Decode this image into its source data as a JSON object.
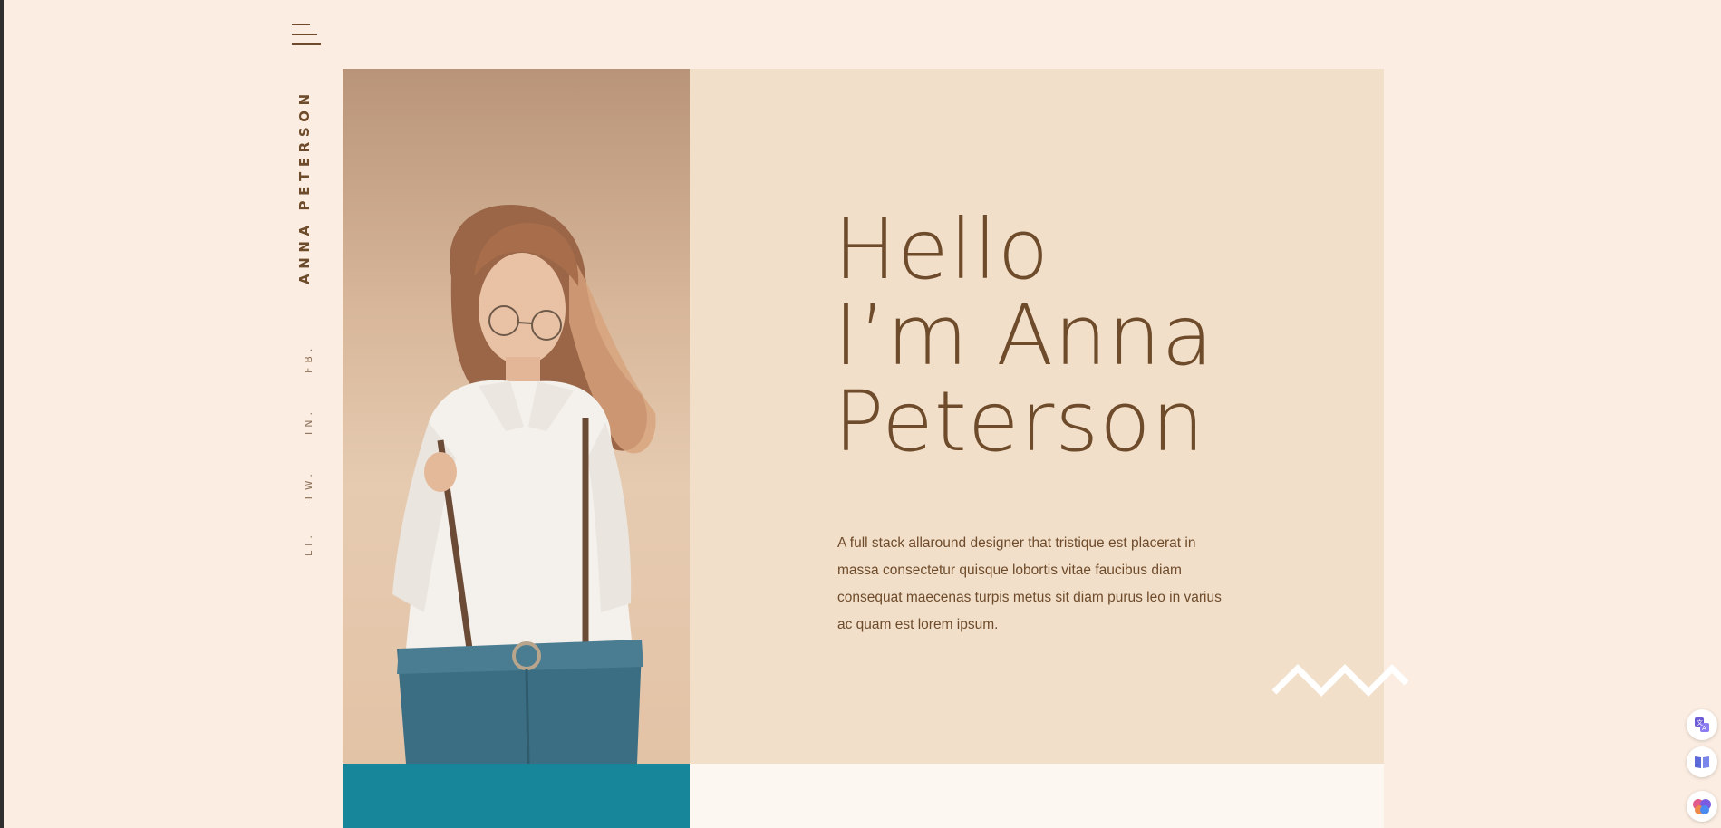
{
  "header": {
    "menu_icon": "hamburger-menu-icon"
  },
  "sidebar": {
    "name": "ANNA PETERSON",
    "social_links": [
      {
        "label": "FB."
      },
      {
        "label": "IN."
      },
      {
        "label": "TW."
      },
      {
        "label": "LI."
      }
    ]
  },
  "hero": {
    "title_lines": [
      "Hello",
      "I’m Anna",
      "Peterson"
    ],
    "description": "A full stack allaround designer that tristique est placerat in massa consectetur quisque lobortis vitae faucibus diam consequat maecenas turpis metus sit diam purus leo in varius ac quam est lorem ipsum.",
    "photo_icon": "portrait-photo"
  },
  "browser_extensions": [
    {
      "icon": "translate-icon"
    },
    {
      "icon": "reader-icon"
    },
    {
      "icon": "brain-icon"
    }
  ],
  "colors": {
    "background": "#fbede1",
    "panel": "#f1dfca",
    "text_brown": "#6e4b2a",
    "teal": "#17859a",
    "cream": "#fdf7f1"
  }
}
